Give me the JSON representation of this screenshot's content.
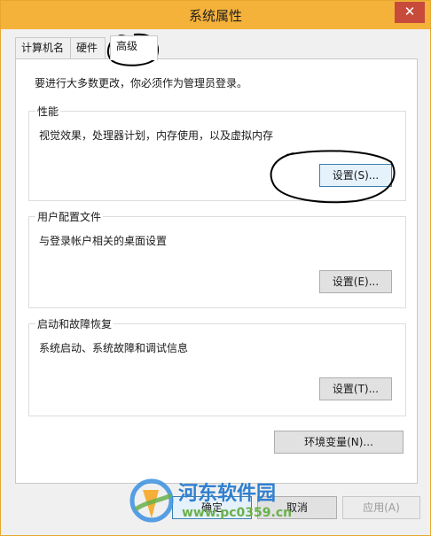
{
  "window": {
    "title": "系统属性",
    "close_glyph": "✕"
  },
  "tabs": [
    {
      "label": "计算机名",
      "active": false
    },
    {
      "label": "硬件",
      "active": false
    },
    {
      "label": "高级",
      "active": true
    }
  ],
  "panel": {
    "admin_note": "要进行大多数更改，你必须作为管理员登录。",
    "groups": [
      {
        "title": "性能",
        "description": "视觉效果，处理器计划，内存使用，以及虚拟内存",
        "button": "设置(S)..."
      },
      {
        "title": "用户配置文件",
        "description": "与登录帐户相关的桌面设置",
        "button": "设置(E)..."
      },
      {
        "title": "启动和故障恢复",
        "description": "系统启动、系统故障和调试信息",
        "button": "设置(T)..."
      }
    ],
    "env_button": "环境变量(N)..."
  },
  "footer": {
    "ok": "确定",
    "cancel": "取消",
    "apply": "应用(A)"
  },
  "watermark": {
    "text": "河东软件园",
    "url": "www.pc0359.cn"
  },
  "colors": {
    "titlebar": "#f5b23a",
    "close": "#c84a3b",
    "focus": "#3c7fb1"
  },
  "icons": [
    "close-icon",
    "watermark-logo-icon"
  ]
}
